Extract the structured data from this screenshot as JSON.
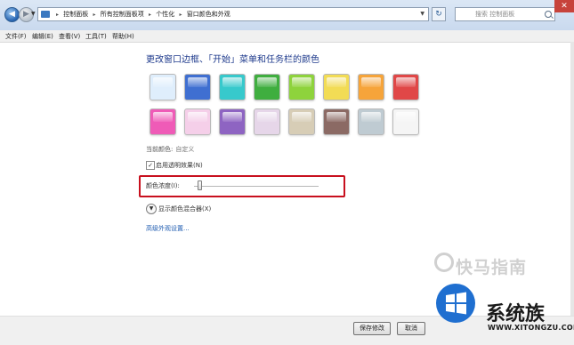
{
  "address_bar": {
    "breadcrumbs": [
      "控制面板",
      "所有控制面板项",
      "个性化",
      "窗口颜色和外观"
    ],
    "search_placeholder": "搜索 控制面板",
    "close_glyph": "✕"
  },
  "menu": {
    "items": [
      "文件(F)",
      "编辑(E)",
      "查看(V)",
      "工具(T)",
      "帮助(H)"
    ]
  },
  "main": {
    "heading": "更改窗口边框、「开始」菜单和任务栏的颜色",
    "swatch_colors": [
      "#dfeefc",
      "#3f6fd1",
      "#37c9cc",
      "#3fae3f",
      "#8ed33c",
      "#f2dc55",
      "#f6a43a",
      "#e04747",
      "#ef5bb7",
      "#f5cfe9",
      "#8e64c2",
      "#e6d6e9",
      "#d7cdb6",
      "#8b6a64",
      "#bfcbd2",
      "#f5f5f5"
    ],
    "current_color_label": "当前颜色:",
    "current_color_value": "自定义",
    "transparency_label": "启用透明效果(N)",
    "transparency_checked": true,
    "intensity_label": "颜色浓度(I):",
    "intensity_value": 0.03,
    "mixer_label": "显示颜色混合器(X)",
    "advanced_link": "高级外观设置..."
  },
  "footer": {
    "save_label": "保存修改",
    "cancel_label": "取消"
  },
  "watermark": {
    "guide_text": "快马指南",
    "brand_text": "系统族",
    "url_text": "WWW.XITONGZU.COM"
  },
  "colors": {
    "highlight_border": "#c8101e",
    "link": "#1e5bb0",
    "heading": "#1e3a8c"
  }
}
